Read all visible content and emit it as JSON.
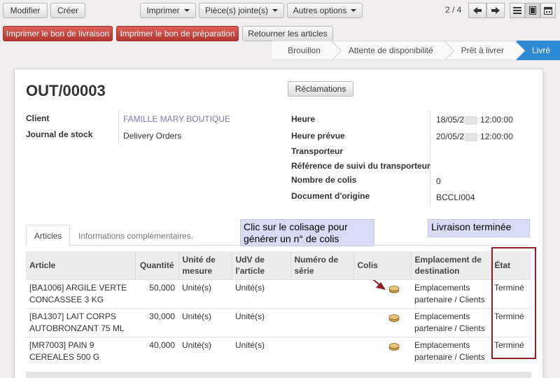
{
  "toolbar": {
    "modifier": "Modifier",
    "creer": "Créer",
    "imprimer": "Imprimer",
    "pieces_jointes": "Pièce(s) jointe(s)",
    "autres_options": "Autres options",
    "pager": "2 / 4"
  },
  "actions": {
    "imprimer_livraison": "Imprimer le bon de livraison",
    "imprimer_preparation": "Imprimer le bon de préparation",
    "retourner": "Retourner les articles"
  },
  "stages": [
    {
      "label": "Brouillon",
      "current": false
    },
    {
      "label": "Attente de disponibilité",
      "current": false
    },
    {
      "label": "Prêt à livrer",
      "current": false
    },
    {
      "label": "Livré",
      "current": true
    }
  ],
  "form": {
    "title": "OUT/00003",
    "reclamations": "Réclamations",
    "client_label": "Client",
    "client_value": "FAMILLE MARY BOUTIQUE",
    "journal_label": "Journal de stock",
    "journal_value": "Delivery Orders",
    "heure_label": "Heure",
    "heure_value": "18/05/2",
    "heure_time": "12:00:00",
    "heure_prevue_label": "Heure prévue",
    "heure_prevue_value": "20/05/2",
    "heure_prevue_time": "12:00:00",
    "transporteur_label": "Transporteur",
    "ref_suivi_label": "Référence de suivi du transporteur",
    "nb_colis_label": "Nombre de colis",
    "nb_colis_value": "0",
    "doc_origine_label": "Document d'origine",
    "doc_origine_value": "BCCLI004"
  },
  "tabs": {
    "articles": "Articles",
    "infos": "Informations complémentaires."
  },
  "annotations": {
    "colisage_line1": "Clic sur le colisage pour",
    "colisage_line2": "générer un n° de colis",
    "livraison": "Livraison terminée"
  },
  "table": {
    "headers": {
      "article": "Article",
      "quantite": "Quantité",
      "unite1": "Unité de",
      "unite2": "mesure",
      "udv1": "UdV de",
      "udv2": "l'article",
      "serie1": "Numéro de",
      "serie2": "série",
      "colis": "Colis",
      "emp1": "Emplacement de",
      "emp2": "destination",
      "etat": "État"
    },
    "rows": [
      {
        "article1": "[BA1006] ARGILE VERTE",
        "article2": "CONCASSEE 3 KG",
        "quantite": "50,000",
        "unite": "Unité(s)",
        "udv": "Unité(s)",
        "emp1": "Emplacements",
        "emp2": "partenaire / Clients",
        "etat": "Terminé"
      },
      {
        "article1": "[BA1307] LAIT CORPS",
        "article2": "AUTOBRONZANT 75 ML",
        "quantite": "30,000",
        "unite": "Unité(s)",
        "udv": "Unité(s)",
        "emp1": "Emplacements",
        "emp2": "partenaire / Clients",
        "etat": "Terminé"
      },
      {
        "article1": "[MR7003] PAIN 9",
        "article2": "CEREALES 500 G",
        "quantite": "40,000",
        "unite": "Unité(s)",
        "udv": "Unité(s)",
        "emp1": "Emplacements",
        "emp2": "partenaire / Clients",
        "etat": "Terminé"
      }
    ]
  },
  "colors": {
    "danger": "#c9302c",
    "current_stage": "#2d8bd6",
    "highlight_box": "#8e1f24",
    "note_bg": "#d9dcf7"
  }
}
